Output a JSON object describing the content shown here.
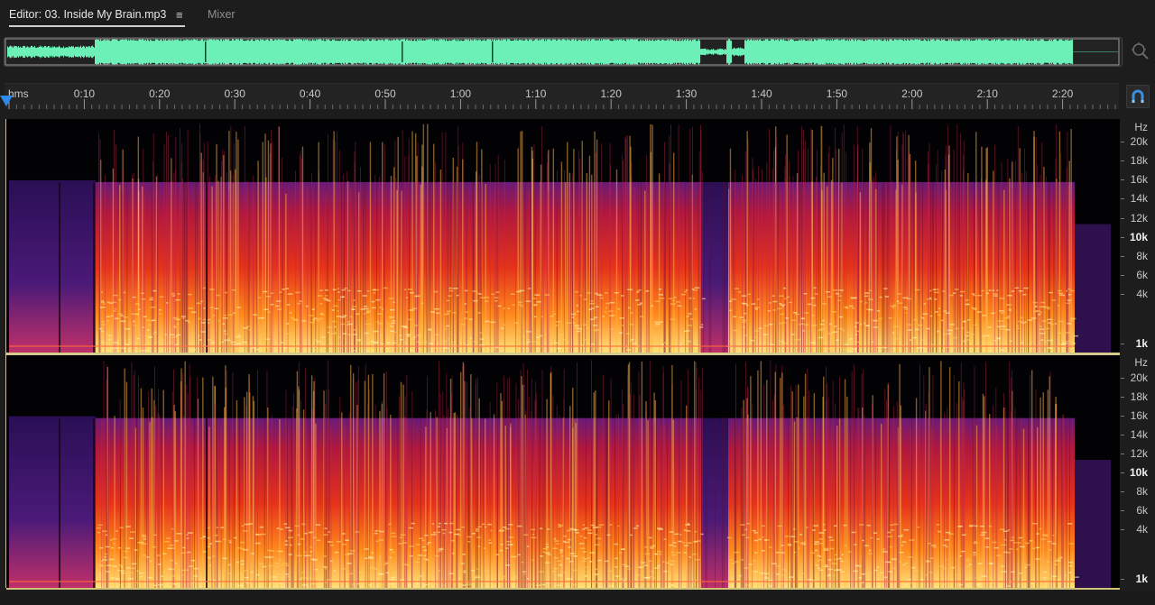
{
  "tabs": {
    "editor_label": "Editor: 03. Inside My Brain.mp3",
    "mixer_label": "Mixer"
  },
  "icons": {
    "panel_menu": "≡",
    "zoom": "zoom-icon",
    "snap": "snap-magnet-icon"
  },
  "ruler": {
    "unit": "hms",
    "ticks": [
      "0:10",
      "0:20",
      "0:30",
      "0:40",
      "0:50",
      "1:00",
      "1:10",
      "1:20",
      "1:30",
      "1:40",
      "1:50",
      "2:00",
      "2:10",
      "2:20"
    ]
  },
  "channel1": {
    "unit": "Hz",
    "ticks": [
      "20k",
      "18k",
      "16k",
      "14k",
      "12k",
      "10k",
      "8k",
      "6k",
      "4k",
      "1k"
    ]
  },
  "channel2": {
    "unit": "Hz",
    "ticks": [
      "20k",
      "18k",
      "16k",
      "14k",
      "12k",
      "10k",
      "8k",
      "6k",
      "4k",
      "1k"
    ]
  },
  "colors": {
    "waveform": "#6df0b8",
    "playhead": "#2d8ceb",
    "spectral_hot": "#ffe27a",
    "spectral_mid": "#ff4a14",
    "spectral_low": "#6a1d7a"
  }
}
